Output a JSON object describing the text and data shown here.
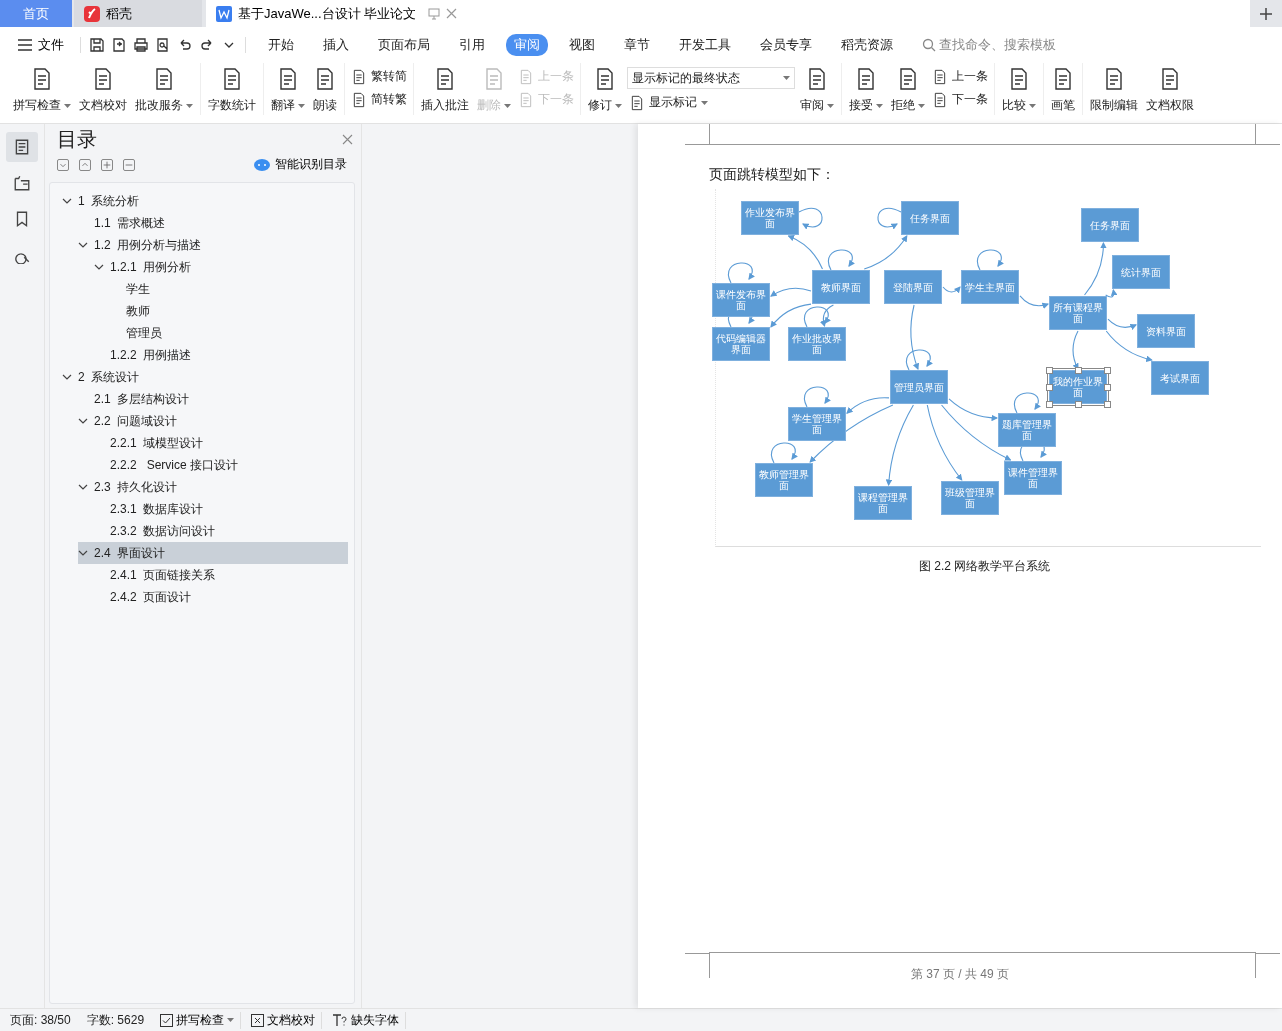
{
  "tabs": [
    {
      "label": "首页",
      "kind": "home",
      "selected": false
    },
    {
      "label": "稻壳",
      "kind": "app",
      "selected": false
    },
    {
      "label": "基于JavaWe...台设计 毕业论文",
      "kind": "doc",
      "selected": true
    }
  ],
  "menu": {
    "file": "文件",
    "items": [
      {
        "label": "开始",
        "selected": false
      },
      {
        "label": "插入",
        "selected": false
      },
      {
        "label": "页面布局",
        "selected": false
      },
      {
        "label": "引用",
        "selected": false
      },
      {
        "label": "审阅",
        "selected": true
      },
      {
        "label": "视图",
        "selected": false
      },
      {
        "label": "章节",
        "selected": false
      },
      {
        "label": "开发工具",
        "selected": false
      },
      {
        "label": "会员专享",
        "selected": false
      },
      {
        "label": "稻壳资源",
        "selected": false
      }
    ],
    "search": {
      "placeholder": "查找命令、搜索模板"
    }
  },
  "ribbon": [
    {
      "items": [
        {
          "kind": "large",
          "label": "拼写检查",
          "dropdown": true,
          "disabled": false
        },
        {
          "kind": "large",
          "label": "文档校对",
          "dropdown": false,
          "disabled": false
        },
        {
          "kind": "large",
          "label": "批改服务",
          "dropdown": true,
          "disabled": false
        }
      ]
    },
    {
      "items": [
        {
          "kind": "large",
          "label": "字数统计",
          "dropdown": false,
          "disabled": false
        }
      ]
    },
    {
      "items": [
        {
          "kind": "large",
          "label": "翻译",
          "dropdown": true,
          "disabled": false
        },
        {
          "kind": "large",
          "label": "朗读",
          "dropdown": false,
          "disabled": false
        }
      ]
    },
    {
      "items": [
        {
          "kind": "stack",
          "items": [
            {
              "kind": "small",
              "label": "繁转简",
              "dropdown": false,
              "disabled": false
            },
            {
              "kind": "small",
              "label": "简转繁",
              "dropdown": false,
              "disabled": false
            }
          ]
        }
      ]
    },
    {
      "items": [
        {
          "kind": "large",
          "label": "插入批注",
          "dropdown": false,
          "disabled": false
        },
        {
          "kind": "large",
          "label": "删除",
          "dropdown": true,
          "disabled": true
        },
        {
          "kind": "stack",
          "items": [
            {
              "kind": "small",
              "label": "上一条",
              "dropdown": false,
              "disabled": true
            },
            {
              "kind": "small",
              "label": "下一条",
              "dropdown": false,
              "disabled": true
            }
          ]
        }
      ]
    },
    {
      "items": [
        {
          "kind": "large",
          "label": "修订",
          "dropdown": true,
          "disabled": false
        },
        {
          "kind": "stack",
          "items": [
            {
              "kind": "select",
              "value": "显示标记的最终状态"
            },
            {
              "kind": "small",
              "label": "显示标记",
              "dropdown": true,
              "disabled": false
            }
          ]
        },
        {
          "kind": "large",
          "label": "审阅",
          "dropdown": true,
          "disabled": false
        }
      ]
    },
    {
      "items": [
        {
          "kind": "large",
          "label": "接受",
          "dropdown": true,
          "disabled": false
        },
        {
          "kind": "large",
          "label": "拒绝",
          "dropdown": true,
          "disabled": false
        },
        {
          "kind": "stack",
          "items": [
            {
              "kind": "small",
              "label": "上一条",
              "dropdown": false,
              "disabled": false
            },
            {
              "kind": "small",
              "label": "下一条",
              "dropdown": false,
              "disabled": false
            }
          ]
        }
      ]
    },
    {
      "items": [
        {
          "kind": "large",
          "label": "比较",
          "dropdown": true,
          "disabled": false
        }
      ]
    },
    {
      "items": [
        {
          "kind": "large",
          "label": "画笔",
          "dropdown": false,
          "disabled": false
        }
      ]
    },
    {
      "items": [
        {
          "kind": "large",
          "label": "限制编辑",
          "dropdown": false,
          "disabled": false
        },
        {
          "kind": "large",
          "label": "文档权限",
          "dropdown": false,
          "disabled": false
        }
      ]
    }
  ],
  "outline": {
    "title": "目录",
    "smart": "智能识别目录"
  },
  "toc": [
    {
      "label": "1  系统分析",
      "expanded": true,
      "selected": false,
      "children": [
        {
          "label": "1.1  需求概述",
          "selected": false
        },
        {
          "label": "1.2  用例分析与描述",
          "expanded": true,
          "selected": false,
          "children": [
            {
              "label": "1.2.1  用例分析",
              "expanded": true,
              "selected": false,
              "children": [
                {
                  "label": "学生",
                  "selected": false
                },
                {
                  "label": "教师",
                  "selected": false
                },
                {
                  "label": "管理员",
                  "selected": false
                }
              ]
            },
            {
              "label": "1.2.2  用例描述",
              "selected": false
            }
          ]
        }
      ]
    },
    {
      "label": "2  系统设计",
      "expanded": true,
      "selected": false,
      "children": [
        {
          "label": "2.1  多层结构设计",
          "selected": false
        },
        {
          "label": "2.2  问题域设计",
          "expanded": true,
          "selected": false,
          "children": [
            {
              "label": "2.2.1  域模型设计",
              "selected": false
            },
            {
              "label": "2.2.2   Service 接口设计",
              "selected": false
            }
          ]
        },
        {
          "label": "2.3  持久化设计",
          "expanded": true,
          "selected": false,
          "children": [
            {
              "label": "2.3.1  数据库设计",
              "selected": false
            },
            {
              "label": "2.3.2  数据访问设计",
              "selected": false
            }
          ]
        },
        {
          "label": "2.4  界面设计",
          "expanded": true,
          "selected": true,
          "children": [
            {
              "label": "2.4.1  页面链接关系",
              "selected": false
            },
            {
              "label": "2.4.2  页面设计",
              "selected": false
            }
          ]
        }
      ]
    }
  ],
  "document": {
    "intro": "页面跳转模型如下：",
    "diagram": {
      "nodes": [
        {
          "label": "作业发布界面",
          "selected": false
        },
        {
          "label": "任务界面",
          "selected": false
        },
        {
          "label": "课件发布界面",
          "selected": false
        },
        {
          "label": "教师界面",
          "selected": false
        },
        {
          "label": "登陆界面",
          "selected": false
        },
        {
          "label": "学生主界面",
          "selected": false
        },
        {
          "label": "代码编辑器界面",
          "selected": false
        },
        {
          "label": "作业批改界面",
          "selected": false
        },
        {
          "label": "管理员界面",
          "selected": false
        },
        {
          "label": "所有课程界面",
          "selected": false
        },
        {
          "label": "任务界面",
          "selected": false
        },
        {
          "label": "统计界面",
          "selected": false
        },
        {
          "label": "资料界面",
          "selected": false
        },
        {
          "label": "考试界面",
          "selected": false
        },
        {
          "label": "我的作业界面",
          "selected": true
        },
        {
          "label": "学生管理界面",
          "selected": false
        },
        {
          "label": "题库管理界面",
          "selected": false
        },
        {
          "label": "教师管理界面",
          "selected": false
        },
        {
          "label": "课件管理界面",
          "selected": false
        },
        {
          "label": "课程管理界面",
          "selected": false
        },
        {
          "label": "班级管理界面",
          "selected": false
        }
      ]
    },
    "caption": "图 2.2 网络教学平台系统",
    "footer": "第 37 页 / 共 49 页"
  },
  "status_bar": [
    {
      "kind": "text",
      "label": "页面: 38/50"
    },
    {
      "kind": "text",
      "label": "字数: 5629"
    },
    {
      "kind": "check",
      "label": "拼写检查",
      "dropdown": true
    },
    {
      "kind": "cross",
      "label": "文档校对",
      "dropdown": false
    },
    {
      "kind": "font",
      "label": "缺失字体",
      "dropdown": false
    }
  ]
}
